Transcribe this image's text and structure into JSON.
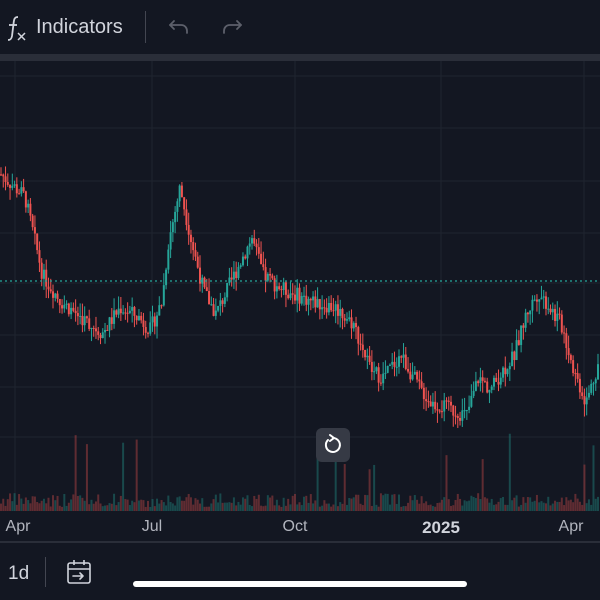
{
  "toolbar": {
    "indicators_label": "Indicators",
    "fx_icon": "function-fx-icon",
    "undo_icon": "undo-icon",
    "redo_icon": "redo-icon"
  },
  "bottom_toolbar": {
    "interval_label": "1d",
    "goto_icon": "calendar-goto-icon"
  },
  "colors": {
    "background": "#131722",
    "grid": "#1f2430",
    "up": "#26a69a",
    "down": "#ef5350",
    "last_price_line": "#26a69a",
    "text": "#d1d4dc"
  },
  "chart_data": {
    "type": "candlestick",
    "x_tick_labels": [
      {
        "label": "Apr",
        "bold": false
      },
      {
        "label": "Jul",
        "bold": false
      },
      {
        "label": "Oct",
        "bold": false
      },
      {
        "label": "2025",
        "bold": true
      },
      {
        "label": "Apr",
        "bold": false
      }
    ],
    "price_trend_relative": [
      [
        0,
        0.92
      ],
      [
        0.04,
        0.85
      ],
      [
        0.07,
        0.6
      ],
      [
        0.1,
        0.52
      ],
      [
        0.14,
        0.46
      ],
      [
        0.17,
        0.42
      ],
      [
        0.2,
        0.5
      ],
      [
        0.23,
        0.47
      ],
      [
        0.25,
        0.43
      ],
      [
        0.27,
        0.52
      ],
      [
        0.28,
        0.7
      ],
      [
        0.3,
        0.88
      ],
      [
        0.32,
        0.7
      ],
      [
        0.34,
        0.55
      ],
      [
        0.36,
        0.48
      ],
      [
        0.38,
        0.56
      ],
      [
        0.4,
        0.64
      ],
      [
        0.42,
        0.72
      ],
      [
        0.44,
        0.6
      ],
      [
        0.47,
        0.56
      ],
      [
        0.52,
        0.52
      ],
      [
        0.56,
        0.5
      ],
      [
        0.59,
        0.45
      ],
      [
        0.62,
        0.3
      ],
      [
        0.64,
        0.28
      ],
      [
        0.67,
        0.35
      ],
      [
        0.7,
        0.25
      ],
      [
        0.72,
        0.2
      ],
      [
        0.75,
        0.18
      ],
      [
        0.78,
        0.16
      ],
      [
        0.8,
        0.28
      ],
      [
        0.82,
        0.24
      ],
      [
        0.84,
        0.3
      ],
      [
        0.86,
        0.35
      ],
      [
        0.88,
        0.48
      ],
      [
        0.9,
        0.55
      ],
      [
        0.92,
        0.5
      ],
      [
        0.94,
        0.44
      ],
      [
        0.96,
        0.3
      ],
      [
        0.98,
        0.2
      ],
      [
        1.0,
        0.32
      ]
    ],
    "last_price_level_relative": 0.6,
    "volume": "bars"
  }
}
